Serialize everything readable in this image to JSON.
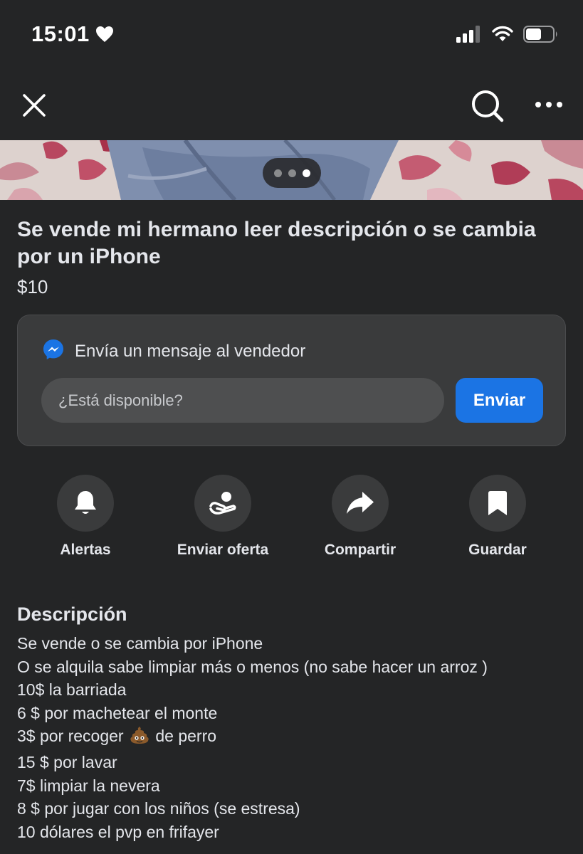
{
  "status_bar": {
    "time": "15:01"
  },
  "listing": {
    "title": "Se vende mi hermano leer descripción o se cambia por un iPhone",
    "price": "$10",
    "photo_pager": {
      "count": 3,
      "active_index": 2
    }
  },
  "message_card": {
    "header": "Envía un mensaje al vendedor",
    "input_value": "¿Está disponible?",
    "send_label": "Enviar"
  },
  "actions": [
    {
      "label": "Alertas",
      "icon": "bell-icon"
    },
    {
      "label": "Enviar oferta",
      "icon": "offer-hand-icon"
    },
    {
      "label": "Compartir",
      "icon": "share-arrow-icon"
    },
    {
      "label": "Guardar",
      "icon": "bookmark-icon"
    }
  ],
  "description": {
    "heading": "Descripción",
    "lines": [
      "Se vende o se cambia por iPhone",
      "O se alquila sabe limpiar más o menos (no sabe hacer un arroz )",
      "10$ la barriada",
      "6 $ por machetear el monte",
      {
        "before": "3$ por recoger ",
        "emoji": "poop-emoji-icon",
        "after": " de perro"
      },
      "15 $ por lavar",
      "7$ limpiar la nevera",
      "8 $ por jugar con los niños (se estresa)",
      "10 dólares el pvp en frifayer"
    ]
  },
  "colors": {
    "background": "#242526",
    "card": "#3a3b3c",
    "accent_blue": "#1b74e4",
    "text": "#e4e6eb"
  }
}
